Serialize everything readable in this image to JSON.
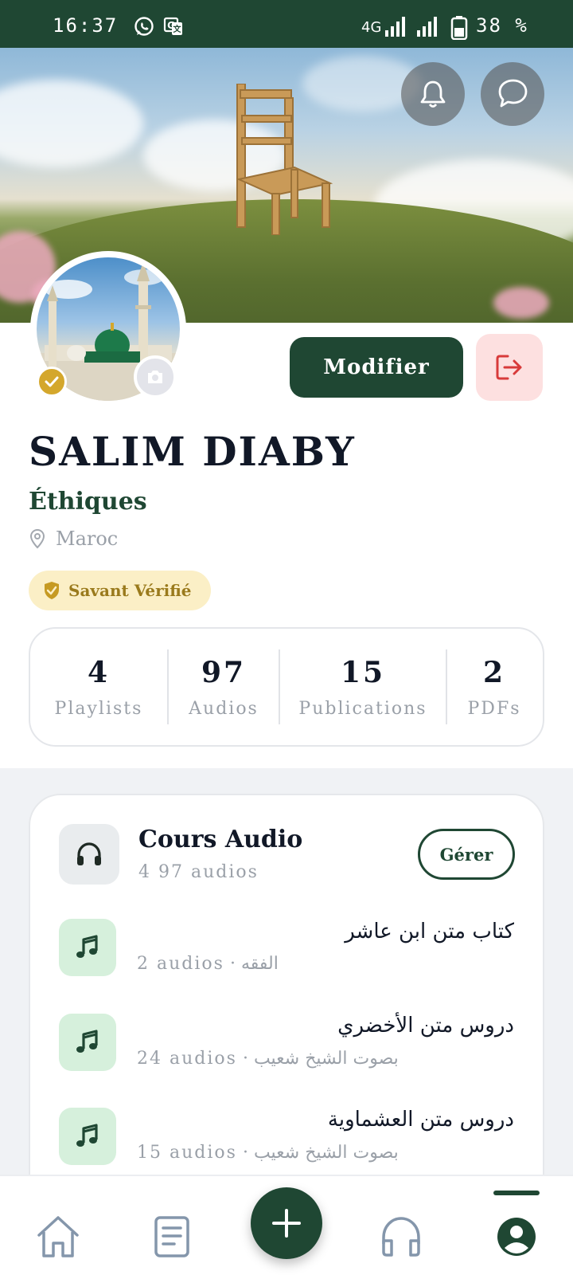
{
  "status_bar": {
    "time": "16:37",
    "network": "4G",
    "battery": "38 %"
  },
  "profile": {
    "name": "SALIM DIABY",
    "specialty": "Éthiques",
    "location": "Maroc",
    "badge": "Savant Vérifié",
    "edit_label": "Modifier"
  },
  "stats": [
    {
      "value": "4",
      "label": "Playlists"
    },
    {
      "value": "97",
      "label": "Audios"
    },
    {
      "value": "15",
      "label": "Publications"
    },
    {
      "value": "2",
      "label": "PDFs"
    }
  ],
  "audio_card": {
    "title": "Cours Audio",
    "subtitle": "4 97 audios",
    "manage_label": "Gérer",
    "playlists": [
      {
        "title": "كتاب متن ابن عاشر",
        "count": "2 audios",
        "meta": "الفقه"
      },
      {
        "title": "دروس متن الأخضري",
        "count": "24 audios",
        "meta": "بصوت الشيخ شعيب"
      },
      {
        "title": "دروس متن العشماوية",
        "count": "15 audios",
        "meta": "بصوت الشيخ شعيب"
      }
    ]
  },
  "colors": {
    "primary": "#1f4733",
    "badge_bg": "#fbefc6",
    "badge_text": "#9a7a1c",
    "logout_bg": "#fde0e0",
    "logout_icon": "#d83a3a"
  },
  "nav": [
    "home-icon",
    "document-icon",
    "plus-icon",
    "headphones-icon",
    "profile-icon"
  ]
}
